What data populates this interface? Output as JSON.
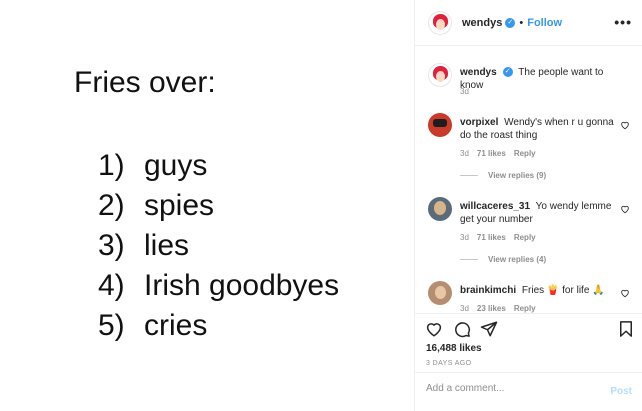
{
  "post": {
    "title": "Fries over:",
    "list": [
      {
        "num": "1)",
        "text": "guys"
      },
      {
        "num": "2)",
        "text": "spies"
      },
      {
        "num": "3)",
        "text": "lies"
      },
      {
        "num": "4)",
        "text": "Irish goodbyes"
      },
      {
        "num": "5)",
        "text": "cries"
      }
    ]
  },
  "header": {
    "username": "wendys",
    "separator": "•",
    "follow_label": "Follow",
    "more_label": "•••"
  },
  "caption": {
    "username": "wendys",
    "text": "The people want to know",
    "time": "3d"
  },
  "comments": [
    {
      "username": "vorpixel",
      "text": "Wendy's when r u gonna do the roast thing",
      "time": "3d",
      "likes": "71 likes",
      "reply": "Reply",
      "view_replies": "View replies (9)"
    },
    {
      "username": "willcaceres_31",
      "text": "Yo wendy lemme get your number",
      "time": "3d",
      "likes": "71 likes",
      "reply": "Reply",
      "view_replies": "View replies (4)"
    },
    {
      "username": "brainkimchi",
      "text": "Fries 🍟 for life 🙏",
      "time": "3d",
      "likes": "23 likes",
      "reply": "Reply"
    }
  ],
  "actions": {
    "likes": "16,488 likes",
    "ago": "3 DAYS AGO"
  },
  "add_comment": {
    "placeholder": "Add a comment...",
    "post_label": "Post"
  },
  "colors": {
    "link": "#3897f0",
    "post_disabled": "#b2dffc",
    "muted": "#8e8e8e"
  }
}
